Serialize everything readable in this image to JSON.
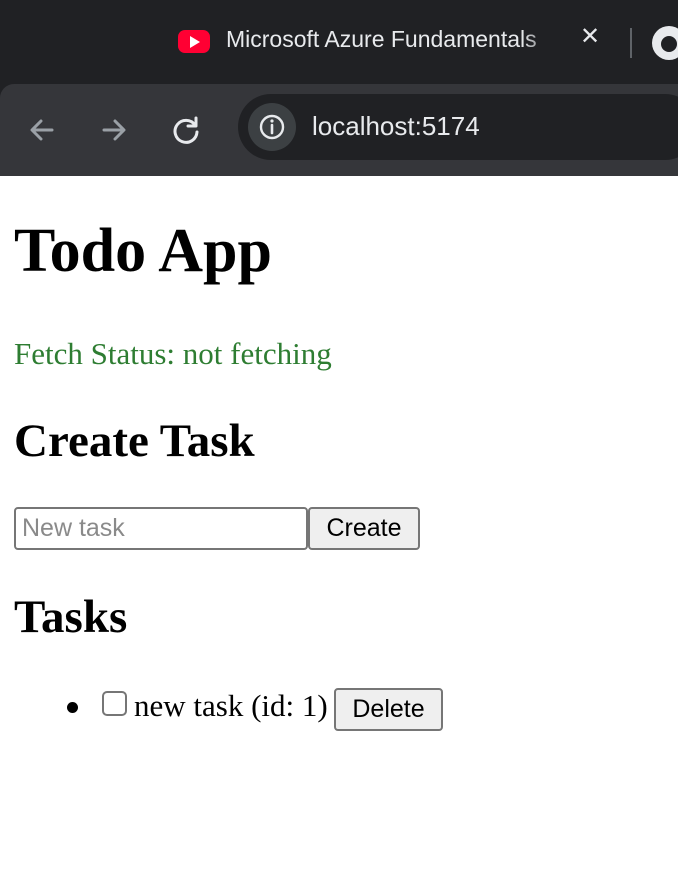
{
  "browser": {
    "tab": {
      "title": "Microsoft Azure Fundamentals",
      "favicon": "youtube-icon"
    },
    "extra_icon": "github-icon",
    "address_bar": {
      "url": "localhost:5174"
    },
    "colors": {
      "tabbar_bg": "#202124",
      "toolbar_bg": "#35363a"
    }
  },
  "app": {
    "title": "Todo App",
    "fetch_status": "Fetch Status: not fetching",
    "create_section": {
      "heading": "Create Task",
      "input_placeholder": "New task",
      "input_value": "",
      "create_label": "Create"
    },
    "tasks_section": {
      "heading": "Tasks",
      "items": [
        {
          "text": "new task (id: 1)",
          "checked": false,
          "delete_label": "Delete"
        }
      ]
    },
    "colors": {
      "status_text": "#2e7d32"
    }
  }
}
